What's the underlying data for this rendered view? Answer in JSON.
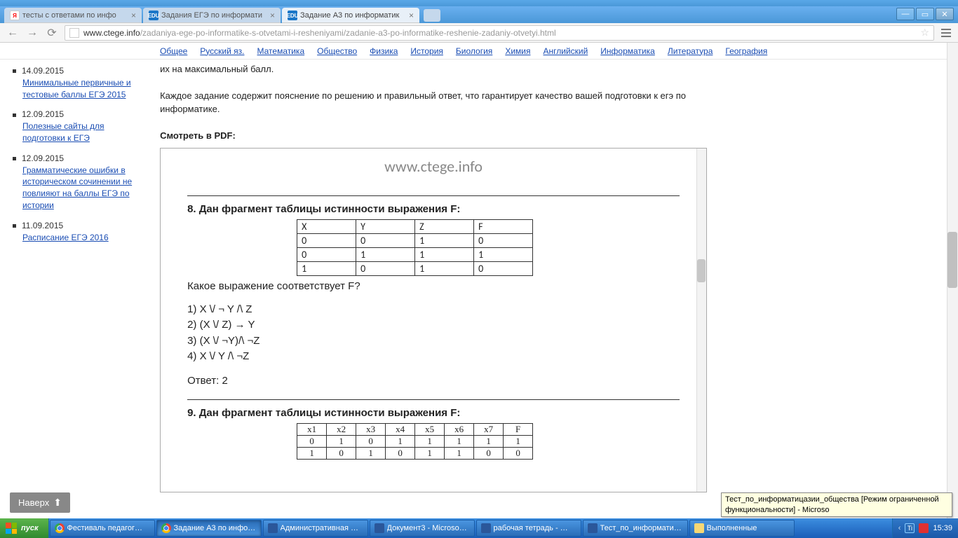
{
  "tabs": [
    {
      "favicon": "Я",
      "title": "тесты с ответами по инфо"
    },
    {
      "favicon": "EDU",
      "title": "Задания ЕГЭ по информати"
    },
    {
      "favicon": "EDU",
      "title": "Задание А3 по информатик"
    }
  ],
  "toolbar": {
    "url_domain": "www.ctege.info",
    "url_path": "/zadaniya-ege-po-informatike-s-otvetami-i-resheniyami/zadanie-a3-po-informatike-reshenie-zadaniy-otvetyi.html"
  },
  "subjects": [
    "Общее",
    "Русский яз.",
    "Математика",
    "Общество",
    "Физика",
    "История",
    "Биология",
    "Химия",
    "Английский",
    "Информатика",
    "Литература",
    "География"
  ],
  "sidebar": [
    {
      "date": "14.09.2015",
      "text": "Минимальные первичные и тестовые баллы ЕГЭ 2015"
    },
    {
      "date": "12.09.2015",
      "text": "Полезные сайты для подготовки к ЕГЭ"
    },
    {
      "date": "12.09.2015",
      "text": "Грамматические ошибки в историческом сочинении не повлияют на баллы ЕГЭ по истории"
    },
    {
      "date": "11.09.2015",
      "text": "Расписание ЕГЭ 2016"
    }
  ],
  "up_button": "Наверх",
  "content": {
    "intro_tail": "их на максимальный балл.",
    "para": "Каждое задание содержит пояснение по решению и правильный ответ, что гарантирует качество вашей подготовки к егэ по информатике.",
    "pdf_label": "Смотреть в PDF:"
  },
  "pdf": {
    "watermark": "www.ctege.info",
    "q8_title": "8. Дан фрагмент таблицы истинности выражения F:",
    "q8_question": "Какое выражение соответствует F?",
    "q8_options": [
      "1) X \\/ ¬ Y /\\ Z",
      "2) (X \\/ Z) → Y",
      "3) (X \\/ ¬Y)/\\ ¬Z",
      "4) X \\/ Y /\\ ¬Z"
    ],
    "q8_answer": "Ответ: 2",
    "q9_title": "9. Дан фрагмент таблицы истинности выражения F:"
  },
  "chart_data": {
    "type": "table",
    "tables": [
      {
        "name": "q8_truth",
        "headers": [
          "X",
          "Y",
          "Z",
          "F"
        ],
        "rows": [
          [
            "0",
            "0",
            "1",
            "0"
          ],
          [
            "0",
            "1",
            "1",
            "1"
          ],
          [
            "1",
            "0",
            "1",
            "0"
          ]
        ]
      },
      {
        "name": "q9_truth",
        "headers": [
          "x1",
          "x2",
          "x3",
          "x4",
          "x5",
          "x6",
          "x7",
          "F"
        ],
        "rows": [
          [
            "0",
            "1",
            "0",
            "1",
            "1",
            "1",
            "1",
            "1"
          ],
          [
            "1",
            "0",
            "1",
            "0",
            "1",
            "1",
            "0",
            "0"
          ]
        ]
      }
    ]
  },
  "tooltip": "Тест_по_информатицазии_общества [Режим ограниченной функциональности] - Microso",
  "taskbar": {
    "start": "пуск",
    "buttons": [
      {
        "icon": "chrome",
        "label": "Фестиваль педагог…"
      },
      {
        "icon": "chrome",
        "label": "Задание А3 по инфо…",
        "active": true
      },
      {
        "icon": "word",
        "label": "Административная …"
      },
      {
        "icon": "word",
        "label": "Документ3 - Microso…"
      },
      {
        "icon": "word",
        "label": "рабочая тетрадь - …"
      },
      {
        "icon": "word",
        "label": "Тест_по_информати…"
      },
      {
        "icon": "folder",
        "label": "Выполненные"
      }
    ],
    "lang": "Ti",
    "clock": "15:39"
  }
}
